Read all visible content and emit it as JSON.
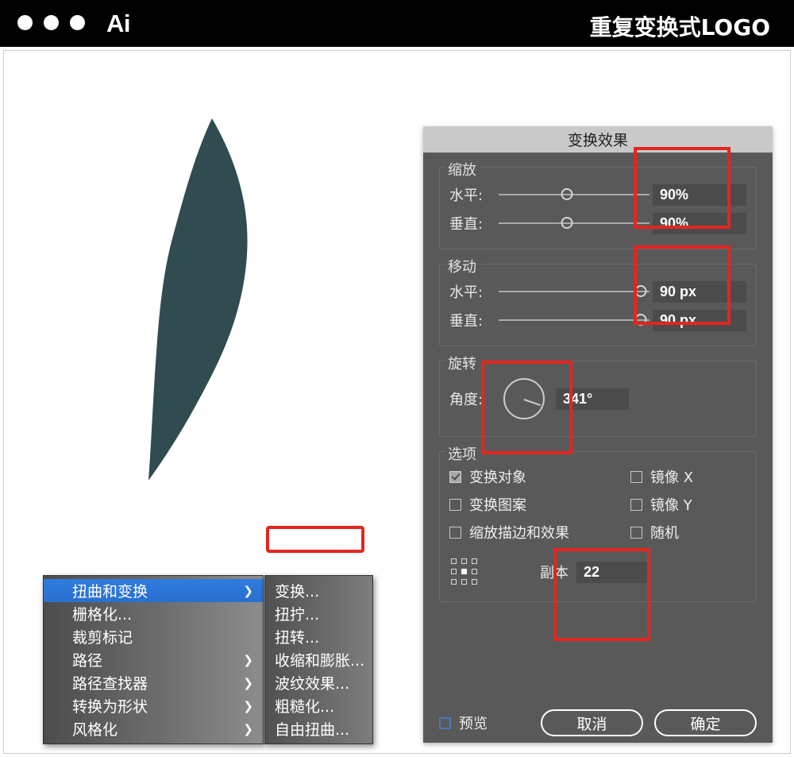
{
  "titlebar": {
    "app_name": "Ai",
    "document_title": "重复变换式LOGO",
    "traffic_lights": [
      "close",
      "minimize",
      "maximize"
    ]
  },
  "canvas": {
    "artwork_fill": "#314c50",
    "artwork_name": "leaf-shape"
  },
  "context_menu": {
    "items": [
      {
        "label": "扭曲和变换",
        "submenu": true,
        "highlighted": true
      },
      {
        "label": "栅格化...",
        "submenu": false,
        "highlighted": false
      },
      {
        "label": "裁剪标记",
        "submenu": false,
        "highlighted": false
      },
      {
        "label": "路径",
        "submenu": true,
        "highlighted": false
      },
      {
        "label": "路径查找器",
        "submenu": true,
        "highlighted": false
      },
      {
        "label": "转换为形状",
        "submenu": true,
        "highlighted": false
      },
      {
        "label": "风格化",
        "submenu": true,
        "highlighted": false
      }
    ],
    "arrow_glyph": "❯"
  },
  "submenu": {
    "items": [
      {
        "label": "变换..."
      },
      {
        "label": "扭拧..."
      },
      {
        "label": "扭转..."
      },
      {
        "label": "收缩和膨胀..."
      },
      {
        "label": "波纹效果..."
      },
      {
        "label": "粗糙化..."
      },
      {
        "label": "自由扭曲..."
      }
    ]
  },
  "dialog": {
    "title": "变换效果",
    "scale": {
      "legend": "缩放",
      "horizontal_label": "水平:",
      "horizontal_value": "90%",
      "horizontal_slider_pct": 45,
      "vertical_label": "垂直:",
      "vertical_value": "90%",
      "vertical_slider_pct": 45
    },
    "move": {
      "legend": "移动",
      "horizontal_label": "水平:",
      "horizontal_value": "90 px",
      "horizontal_slider_pct": 94,
      "vertical_label": "垂直:",
      "vertical_value": "90 px",
      "vertical_slider_pct": 94
    },
    "rotate": {
      "legend": "旋转",
      "angle_label": "角度:",
      "angle_value": "341°",
      "dial_angle_deg": 19
    },
    "options": {
      "legend": "选项",
      "checkboxes": [
        {
          "label": "变换对象",
          "checked": true
        },
        {
          "label": "镜像 X",
          "checked": false
        },
        {
          "label": "变换图案",
          "checked": false
        },
        {
          "label": "镜像 Y",
          "checked": false
        },
        {
          "label": "缩放描边和效果",
          "checked": false
        },
        {
          "label": "随机",
          "checked": false
        }
      ],
      "anchor_label": "anchor-point-selector",
      "anchor_selected": "center",
      "copies_label": "副本",
      "copies_value": "22"
    },
    "footer": {
      "preview_label": "预览",
      "preview_checked": false,
      "cancel_label": "取消",
      "ok_label": "确定"
    }
  },
  "annotations": {
    "highlight_color": "#e3261f",
    "boxes": [
      {
        "name": "scale-values-highlight"
      },
      {
        "name": "move-values-highlight"
      },
      {
        "name": "rotate-angle-highlight"
      },
      {
        "name": "copies-highlight"
      },
      {
        "name": "transform-menu-item-highlight"
      }
    ]
  }
}
